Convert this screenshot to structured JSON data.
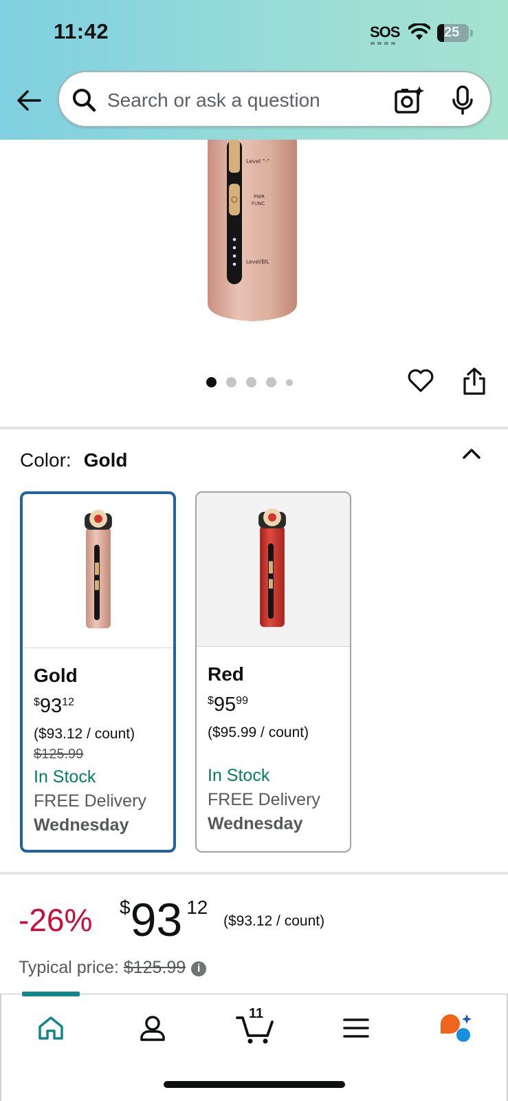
{
  "status_bar": {
    "time": "11:42",
    "sos": "SOS",
    "battery": "25"
  },
  "search": {
    "placeholder": "Search or ask a question"
  },
  "icons": {
    "back": "back-arrow-icon",
    "search": "search-icon",
    "camera": "camera-sparkle-icon",
    "mic": "microphone-icon",
    "heart": "heart-icon",
    "share": "share-icon",
    "chevron": "chevron-up-icon",
    "info": "info-icon",
    "home": "home-icon",
    "account": "account-icon",
    "cart": "cart-icon",
    "menu": "menu-icon",
    "rufus": "rufus-chat-icon"
  },
  "product_image": {
    "labels": [
      "Level \"-\"",
      "PWR",
      "FUNC",
      "Level/BIL"
    ],
    "carousel": {
      "count": 5,
      "active_index": 0
    }
  },
  "color": {
    "label": "Color:",
    "selected": "Gold"
  },
  "swatches": [
    {
      "name": "Gold",
      "price_whole": "93",
      "price_cents": "12",
      "currency": "$",
      "unit_price": "($93.12 / count)",
      "list_price": "$125.99",
      "stock": "In Stock",
      "delivery": "FREE Delivery",
      "day": "Wednesday",
      "selected": true
    },
    {
      "name": "Red",
      "price_whole": "95",
      "price_cents": "99",
      "currency": "$",
      "unit_price": "($95.99 / count)",
      "list_price": "",
      "stock": "In Stock",
      "delivery": "FREE Delivery",
      "day": "Wednesday",
      "selected": false
    }
  ],
  "price": {
    "discount": "-26%",
    "currency": "$",
    "whole": "93",
    "cents": "12",
    "per_count": "($93.12 / count)",
    "typical_label": "Typical price:",
    "typical_value": "$125.99"
  },
  "nav": {
    "cart_count": "11",
    "active": "home"
  },
  "colors": {
    "accent_blue": "#2162a1",
    "deal_red": "#cc0c39",
    "stock_green": "#067d62",
    "teal": "#13868c",
    "gold_body": "#dcae9c",
    "red_body": "#c8332b"
  }
}
